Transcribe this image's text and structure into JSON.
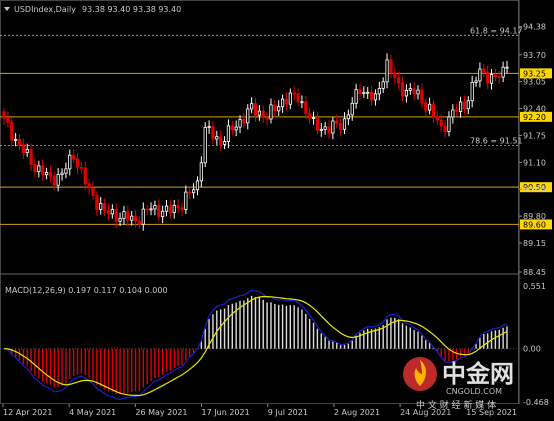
{
  "window": {
    "title": "USDIndex,Daily",
    "ohlc": "93.38 93.40 93.38 93.40",
    "dropdown_icon": "triangle-down-icon"
  },
  "colors": {
    "background": "#000000",
    "bull": "#ffffff",
    "bear": "#e00000",
    "level_line": "#d4a017",
    "level_label_bg": "#ffd700",
    "fib_line": "#b0b0b0",
    "macd_line": "#1e1ec8",
    "signal_line": "#e8e800",
    "axis_text": "#c8c8c8"
  },
  "chart_data": {
    "type": "candlestick",
    "title": "USDIndex,Daily",
    "ylim": [
      88.45,
      94.54
    ],
    "y_ticks": [
      94.38,
      93.7,
      93.05,
      92.4,
      91.75,
      91.1,
      90.45,
      89.8,
      89.15,
      88.45
    ],
    "x_ticks": [
      "12 Apr 2021",
      "4 May 2021",
      "26 May 2021",
      "17 Jun 2021",
      "9 Jul 2021",
      "2 Aug 2021",
      "24 Aug 2021",
      "15 Sep 2021"
    ],
    "levels": [
      {
        "label": "93.25",
        "value": 93.25
      },
      {
        "label": "92.20",
        "value": 92.2
      },
      {
        "label": "90.50",
        "value": 90.5
      },
      {
        "label": "89.60",
        "value": 89.6
      }
    ],
    "fib_levels": [
      {
        "label": "61.8 = 94.17",
        "value": 94.17
      },
      {
        "label": "78.6 = 91.51",
        "value": 91.51
      }
    ],
    "close_anchors": [
      {
        "i": 0,
        "v": 92.1
      },
      {
        "i": 4,
        "v": 91.5
      },
      {
        "i": 8,
        "v": 91.0
      },
      {
        "i": 12,
        "v": 90.7
      },
      {
        "i": 15,
        "v": 90.8
      },
      {
        "i": 18,
        "v": 91.3
      },
      {
        "i": 22,
        "v": 90.4
      },
      {
        "i": 26,
        "v": 89.9
      },
      {
        "i": 30,
        "v": 89.8
      },
      {
        "i": 34,
        "v": 89.7
      },
      {
        "i": 38,
        "v": 90.0
      },
      {
        "i": 42,
        "v": 89.9
      },
      {
        "i": 46,
        "v": 90.1
      },
      {
        "i": 50,
        "v": 90.6
      },
      {
        "i": 52,
        "v": 91.9
      },
      {
        "i": 56,
        "v": 91.6
      },
      {
        "i": 60,
        "v": 92.0
      },
      {
        "i": 64,
        "v": 92.4
      },
      {
        "i": 68,
        "v": 92.2
      },
      {
        "i": 72,
        "v": 92.6
      },
      {
        "i": 76,
        "v": 92.7
      },
      {
        "i": 80,
        "v": 92.0
      },
      {
        "i": 84,
        "v": 91.9
      },
      {
        "i": 88,
        "v": 92.1
      },
      {
        "i": 92,
        "v": 92.9
      },
      {
        "i": 96,
        "v": 92.6
      },
      {
        "i": 99,
        "v": 93.5
      },
      {
        "i": 102,
        "v": 92.9
      },
      {
        "i": 106,
        "v": 92.8
      },
      {
        "i": 110,
        "v": 92.4
      },
      {
        "i": 113,
        "v": 91.9
      },
      {
        "i": 116,
        "v": 92.3
      },
      {
        "i": 119,
        "v": 92.5
      },
      {
        "i": 123,
        "v": 93.3
      },
      {
        "i": 127,
        "v": 93.1
      },
      {
        "i": 130,
        "v": 93.4
      }
    ]
  },
  "macd": {
    "label": "MACD(12,26,9) 0.197 0.117 0.104 0.000",
    "ylim": [
      -0.468,
      0.551
    ],
    "y_ticks": [
      "0.551",
      "0.00",
      "-0.468"
    ],
    "zero": 0.0
  },
  "watermark": {
    "brand": "中金网",
    "domain": "CNGOLD.COM",
    "tagline": "中 文 财 经 新 媒 体",
    "logo_icon": "cngold-logo-icon"
  }
}
